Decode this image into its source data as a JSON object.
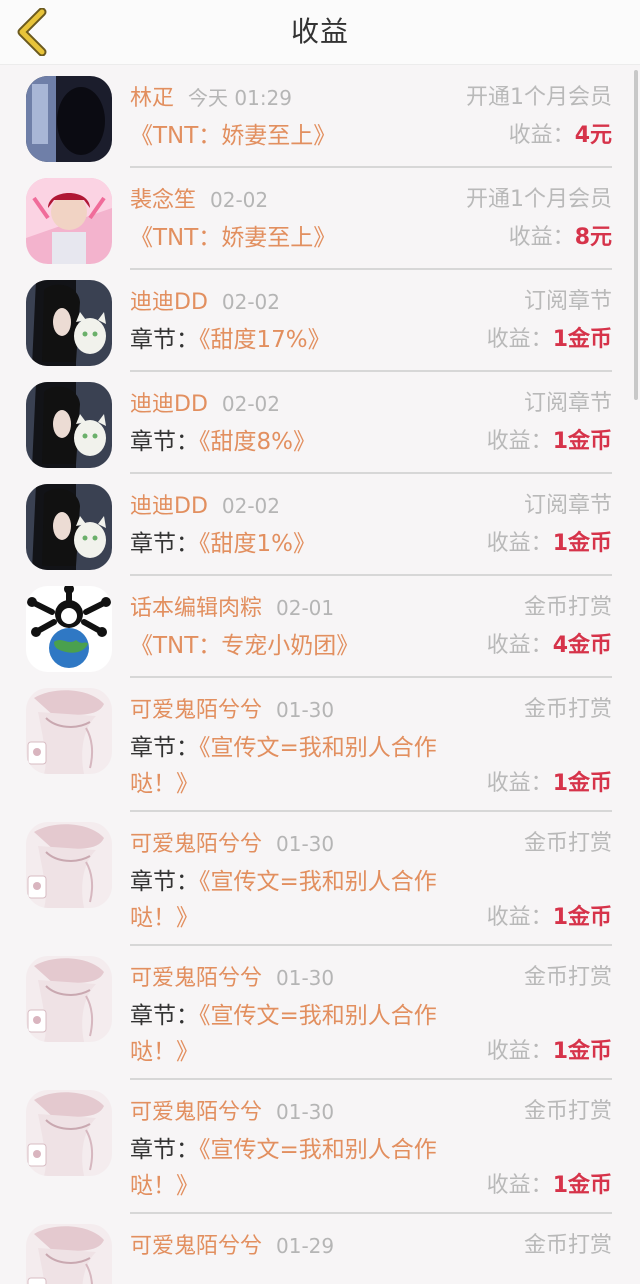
{
  "header": {
    "title": "收益"
  },
  "colors": {
    "name": "#e28f5f",
    "earning": "#d6334a",
    "meta": "#b9b9b9",
    "back_icon": "#e8c43a"
  },
  "items": [
    {
      "name": "林疋",
      "time": "今天 01:29",
      "type": "开通1个月会员",
      "prefix": "",
      "chapter": "《TNT：娇妻至上》",
      "earn_label": "收益：",
      "earn_value": "4元",
      "avatar": "dark-window"
    },
    {
      "name": "裴念笙",
      "time": "02-02",
      "type": "开通1个月会员",
      "prefix": "",
      "chapter": "《TNT：娇妻至上》",
      "earn_label": "收益：",
      "earn_value": "8元",
      "avatar": "pink-girl"
    },
    {
      "name": "迪迪DD",
      "time": "02-02",
      "type": "订阅章节",
      "prefix": "章节：",
      "chapter": "《甜度17%》",
      "earn_label": "收益：",
      "earn_value": "1金币",
      "avatar": "girl-cat"
    },
    {
      "name": "迪迪DD",
      "time": "02-02",
      "type": "订阅章节",
      "prefix": "章节：",
      "chapter": "《甜度8%》",
      "earn_label": "收益：",
      "earn_value": "1金币",
      "avatar": "girl-cat"
    },
    {
      "name": "迪迪DD",
      "time": "02-02",
      "type": "订阅章节",
      "prefix": "章节：",
      "chapter": "《甜度1%》",
      "earn_label": "收益：",
      "earn_value": "1金币",
      "avatar": "girl-cat"
    },
    {
      "name": "话本编辑肉粽",
      "time": "02-01",
      "type": "金币打赏",
      "prefix": "",
      "chapter": "《TNT：专宠小奶团》",
      "earn_label": "收益：",
      "earn_value": "4金币",
      "avatar": "globe-bones"
    },
    {
      "name": "可爱鬼陌兮兮",
      "time": "01-30",
      "type": "金币打赏",
      "prefix": "章节：",
      "chapter": "《宣传文=我和别人合作哒！》",
      "earn_label": "收益：",
      "earn_value": "1金币",
      "avatar": "pale-anime"
    },
    {
      "name": "可爱鬼陌兮兮",
      "time": "01-30",
      "type": "金币打赏",
      "prefix": "章节：",
      "chapter": "《宣传文=我和别人合作哒！》",
      "earn_label": "收益：",
      "earn_value": "1金币",
      "avatar": "pale-anime"
    },
    {
      "name": "可爱鬼陌兮兮",
      "time": "01-30",
      "type": "金币打赏",
      "prefix": "章节：",
      "chapter": "《宣传文=我和别人合作哒！》",
      "earn_label": "收益：",
      "earn_value": "1金币",
      "avatar": "pale-anime"
    },
    {
      "name": "可爱鬼陌兮兮",
      "time": "01-30",
      "type": "金币打赏",
      "prefix": "章节：",
      "chapter": "《宣传文=我和别人合作哒！》",
      "earn_label": "收益：",
      "earn_value": "1金币",
      "avatar": "pale-anime"
    },
    {
      "name": "可爱鬼陌兮兮",
      "time": "01-29",
      "type": "金币打赏",
      "prefix": "",
      "chapter": "",
      "earn_label": "",
      "earn_value": "",
      "avatar": "pale-anime"
    }
  ]
}
